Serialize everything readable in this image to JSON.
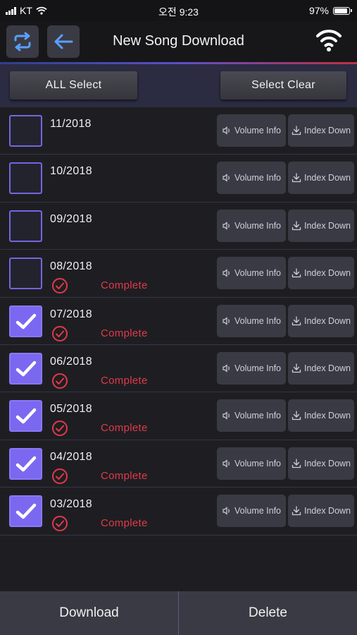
{
  "status_bar": {
    "carrier": "KT",
    "time": "오전 9:23",
    "battery_percent_label": "97%",
    "battery_level": 0.97
  },
  "header": {
    "title": "New Song Download",
    "refresh_icon": "refresh-icon",
    "back_icon": "back-arrow-icon",
    "wifi_icon": "wifi-icon"
  },
  "toolbar": {
    "all_select_label": "ALL Select",
    "select_clear_label": "Select Clear"
  },
  "rows": [
    {
      "date": "11/2018",
      "checked": false,
      "status": ""
    },
    {
      "date": "10/2018",
      "checked": false,
      "status": ""
    },
    {
      "date": "09/2018",
      "checked": false,
      "status": ""
    },
    {
      "date": "08/2018",
      "checked": false,
      "status": "Complete"
    },
    {
      "date": "07/2018",
      "checked": true,
      "status": "Complete"
    },
    {
      "date": "06/2018",
      "checked": true,
      "status": "Complete"
    },
    {
      "date": "05/2018",
      "checked": true,
      "status": "Complete"
    },
    {
      "date": "04/2018",
      "checked": true,
      "status": "Complete"
    },
    {
      "date": "03/2018",
      "checked": true,
      "status": "Complete"
    }
  ],
  "row_buttons": {
    "volume_info_label": "Volume Info",
    "index_down_label": "Index Down"
  },
  "footer": {
    "download_label": "Download",
    "delete_label": "Delete"
  },
  "colors": {
    "accent": "#7a68f0",
    "complete": "#e03a4a",
    "button_bg": "#3a3a44",
    "select_bar": "#2b2b42"
  }
}
